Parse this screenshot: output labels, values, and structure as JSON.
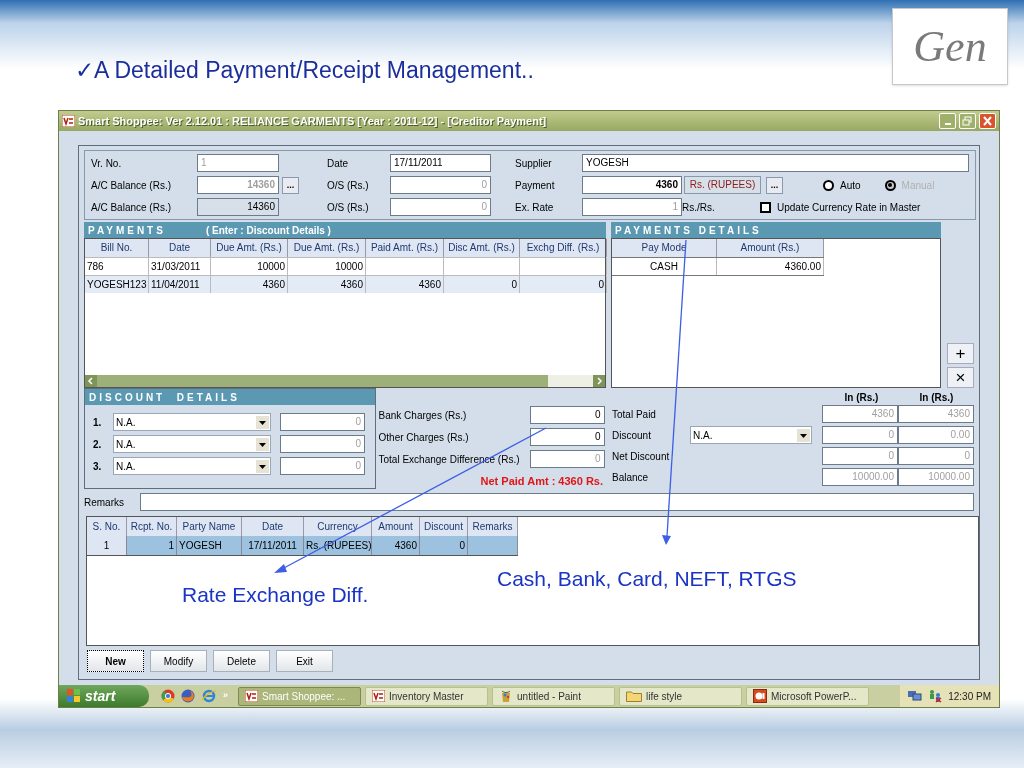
{
  "slide": {
    "check": "✓",
    "title": "A Detailed Payment/Receipt Management..",
    "logo": "Gen"
  },
  "window": {
    "title": "Smart Shoppee: Ver 2.12.01  : RELIANCE GARMENTS [Year : 2011-12] - [Creditor Payment]"
  },
  "header": {
    "vr_no": {
      "label": "Vr. No.",
      "value": "1"
    },
    "ac_balance": {
      "label": "A/C Balance (Rs.)",
      "value": "14360",
      "browse": "..."
    },
    "ac_balance_2": {
      "label": "A/C Balance (Rs.)",
      "value": "14360"
    },
    "date": {
      "label": "Date",
      "value": "17/11/2011"
    },
    "os": {
      "label": "O/S (Rs.)",
      "value": "0"
    },
    "os_2": {
      "label": "O/S (Rs.)",
      "value": "0"
    },
    "supplier": {
      "label": "Supplier",
      "value": "YOGESH"
    },
    "payment": {
      "label": "Payment",
      "value": "4360",
      "currency": "Rs. (RUPEES)",
      "browse": "..."
    },
    "ex_rate": {
      "label": "Ex. Rate",
      "value": "1",
      "unit": "Rs./Rs."
    },
    "rate_mode": [
      {
        "label": "Auto",
        "selected": false,
        "disabled": false
      },
      {
        "label": "Manual",
        "selected": true,
        "disabled": true
      }
    ],
    "update_rate": {
      "label": "Update Currency Rate in Master",
      "checked": false
    }
  },
  "payments": {
    "title": "PAYMENTS",
    "hint": "( Enter : Discount Details )",
    "columns": [
      "Bill No.",
      "Date",
      "Due Amt. (Rs.)",
      "Due Amt. (Rs.)",
      "Paid Amt. (Rs.)",
      "Disc Amt. (Rs.)",
      "Exchg Diff. (Rs.)"
    ],
    "rows": [
      {
        "selected": false,
        "cells": [
          "786",
          "31/03/2011",
          "10000",
          "10000"
        ]
      },
      {
        "selected": true,
        "cells": [
          "YOGESH123",
          "11/04/2011",
          "4360",
          "4360",
          "4360",
          "0",
          "0"
        ]
      }
    ]
  },
  "payment_details": {
    "title": "PAYMENTS DETAILS",
    "columns": [
      "Pay Mode",
      "Amount (Rs.)"
    ],
    "rows": [
      [
        "CASH",
        "4360.00"
      ]
    ]
  },
  "row_buttons": [
    "+",
    "×"
  ],
  "discount": {
    "title": "DISCOUNT  DETAILS",
    "items": [
      {
        "number": "1.",
        "option": "N.A.",
        "value": "0"
      },
      {
        "number": "2.",
        "option": "N.A.",
        "value": "0"
      },
      {
        "number": "3.",
        "option": "N.A.",
        "value": "0"
      }
    ]
  },
  "charges": [
    {
      "label": "Bank Charges (Rs.)",
      "value": "0",
      "disabled": false
    },
    {
      "label": "Other Charges (Rs.)",
      "value": "0",
      "disabled": false
    },
    {
      "label": "Total Exchange Difference (Rs.)",
      "value": "0",
      "disabled": true
    }
  ],
  "net_paid": "Net Paid Amt : 4360 Rs.",
  "summary": {
    "columns": [
      "In (Rs.)",
      "In (Rs.)"
    ],
    "rows": [
      {
        "label": "Total Paid",
        "values": [
          "4360",
          "4360"
        ]
      },
      {
        "label": "Discount",
        "option": "N.A.",
        "values": [
          "0",
          "0.00"
        ]
      },
      {
        "label": "Net Discount",
        "values": [
          "0",
          "0"
        ]
      },
      {
        "label": "Balance",
        "values": [
          "10000.00",
          "10000.00"
        ]
      }
    ]
  },
  "remarks": {
    "label": "Remarks"
  },
  "receipts": {
    "columns": [
      "S. No.",
      "Rcpt. No.",
      "Party Name",
      "Date",
      "Currency",
      "Amount",
      "Discount",
      "Remarks"
    ],
    "rows": [
      {
        "selected": true,
        "cells": [
          "1",
          "1",
          "YOGESH",
          "17/11/2011",
          "Rs. (RUPEES)",
          "4360",
          "0"
        ]
      }
    ]
  },
  "buttons": [
    {
      "label": "New",
      "focused": true
    },
    {
      "label": "Modify",
      "focused": false
    },
    {
      "label": "Delete",
      "focused": false
    },
    {
      "label": "Exit",
      "focused": false
    }
  ],
  "annotations": [
    "Rate Exchange Diff.",
    "Cash, Bank, Card, NEFT, RTGS"
  ],
  "taskbar": {
    "start": "start",
    "more": "»",
    "tasks": [
      {
        "kind": "app",
        "label": "Smart Shoppee: ...",
        "selected": true
      },
      {
        "kind": "app",
        "label": "Inventory Master",
        "selected": false
      },
      {
        "kind": "paint",
        "label": "untitled - Paint",
        "selected": false
      },
      {
        "kind": "folder",
        "label": "life style",
        "selected": false
      },
      {
        "kind": "powerpoint",
        "label": "Microsoft PowerP...",
        "selected": false
      }
    ],
    "clock": "12:30 PM"
  }
}
